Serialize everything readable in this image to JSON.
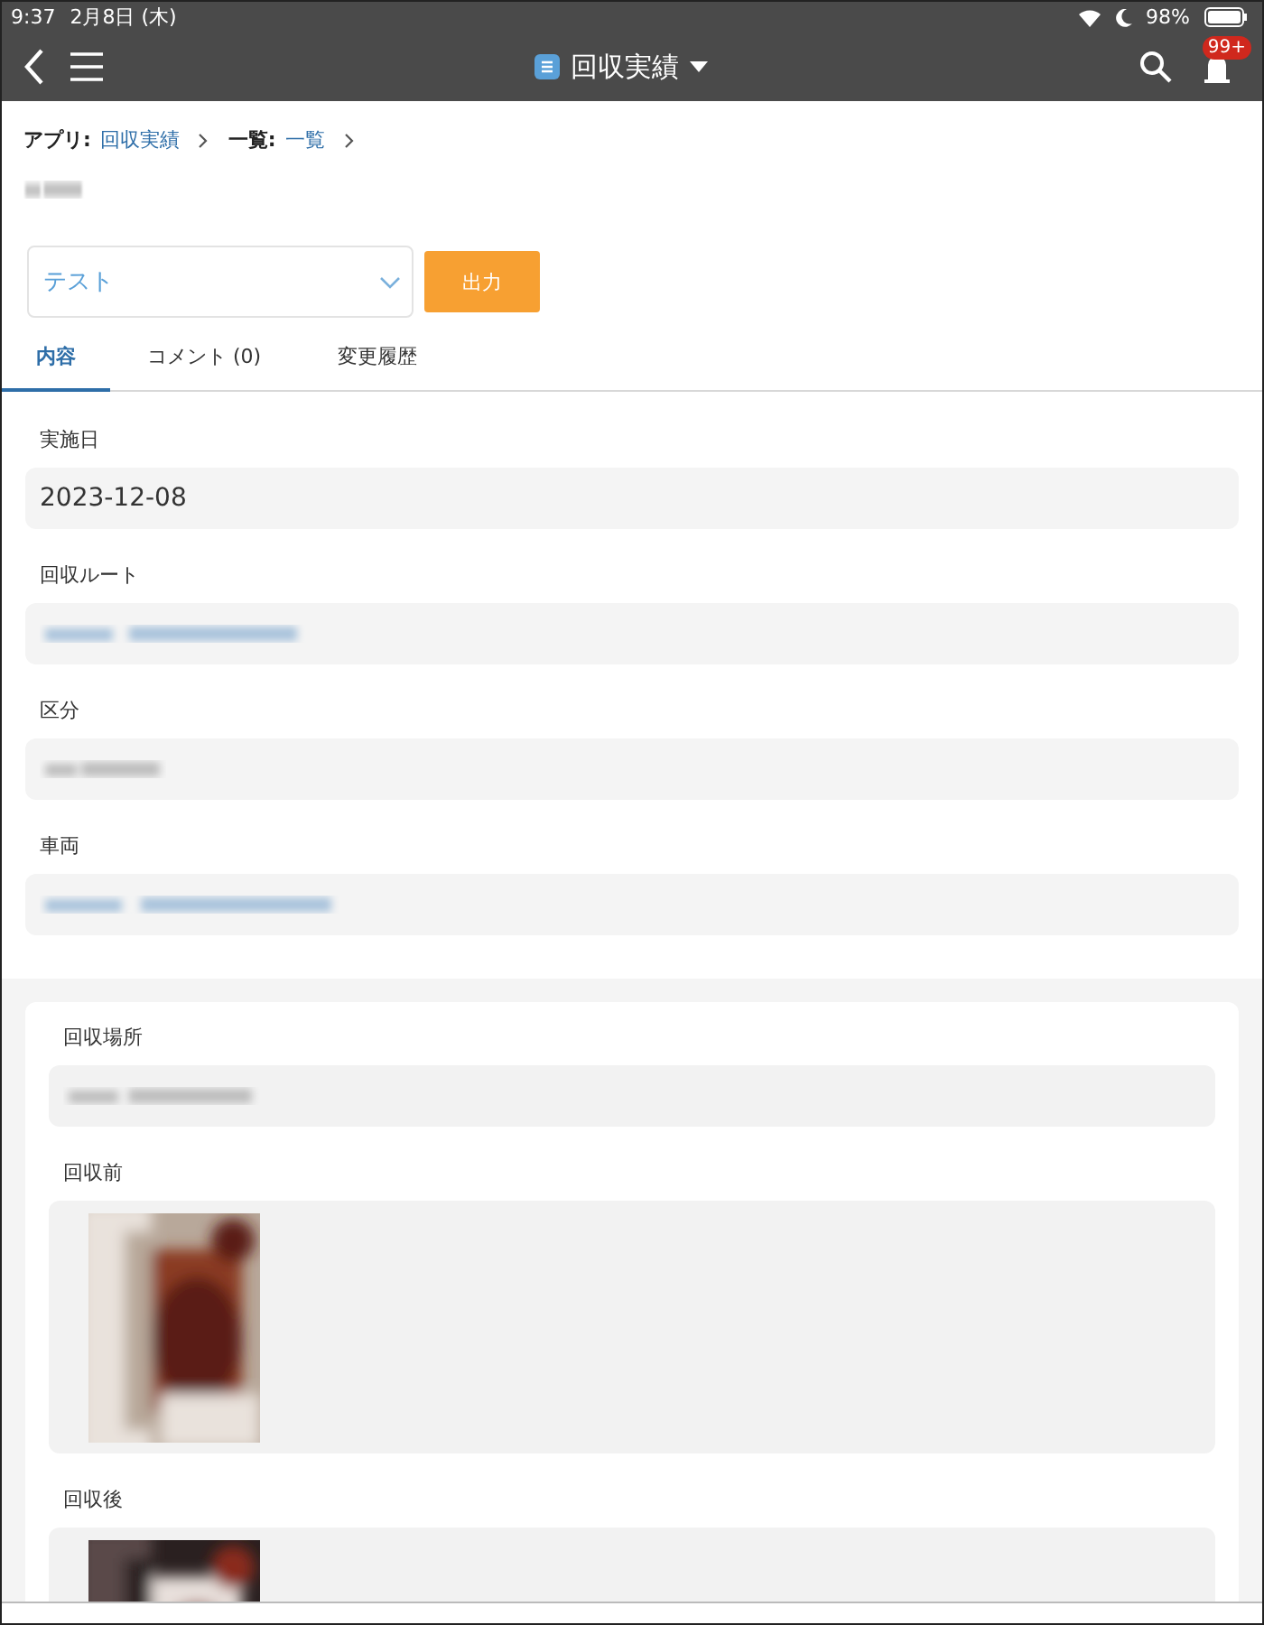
{
  "status_bar": {
    "time": "9:37",
    "date": "2月8日 (木)",
    "battery": "98%"
  },
  "nav": {
    "title": "回収実績",
    "badge": "99+"
  },
  "breadcrumb": [
    {
      "label": "アプリ:",
      "value": "回収実績"
    },
    {
      "label": "一覧:",
      "value": "一覧"
    }
  ],
  "record_title": {
    "kind": "blurred"
  },
  "view_select": {
    "value": "テスト"
  },
  "output_button": "出力",
  "tabs": [
    {
      "label": "内容",
      "selected": true
    },
    {
      "label": "コメント (0)",
      "selected": false
    },
    {
      "label": "変更履歴",
      "selected": false
    }
  ],
  "fields": [
    {
      "label": "実施日",
      "kind": "text",
      "value": "2023-12-08"
    },
    {
      "label": "回収ルート",
      "kind": "blurred",
      "link": true
    },
    {
      "label": "区分",
      "kind": "blurred",
      "link": false
    },
    {
      "label": "車両",
      "kind": "blurred",
      "link": true
    }
  ],
  "subtable": [
    {
      "label": "回収場所",
      "kind": "blurred",
      "link": false
    },
    {
      "label": "回収前"
    },
    {
      "label": "回収後"
    }
  ]
}
